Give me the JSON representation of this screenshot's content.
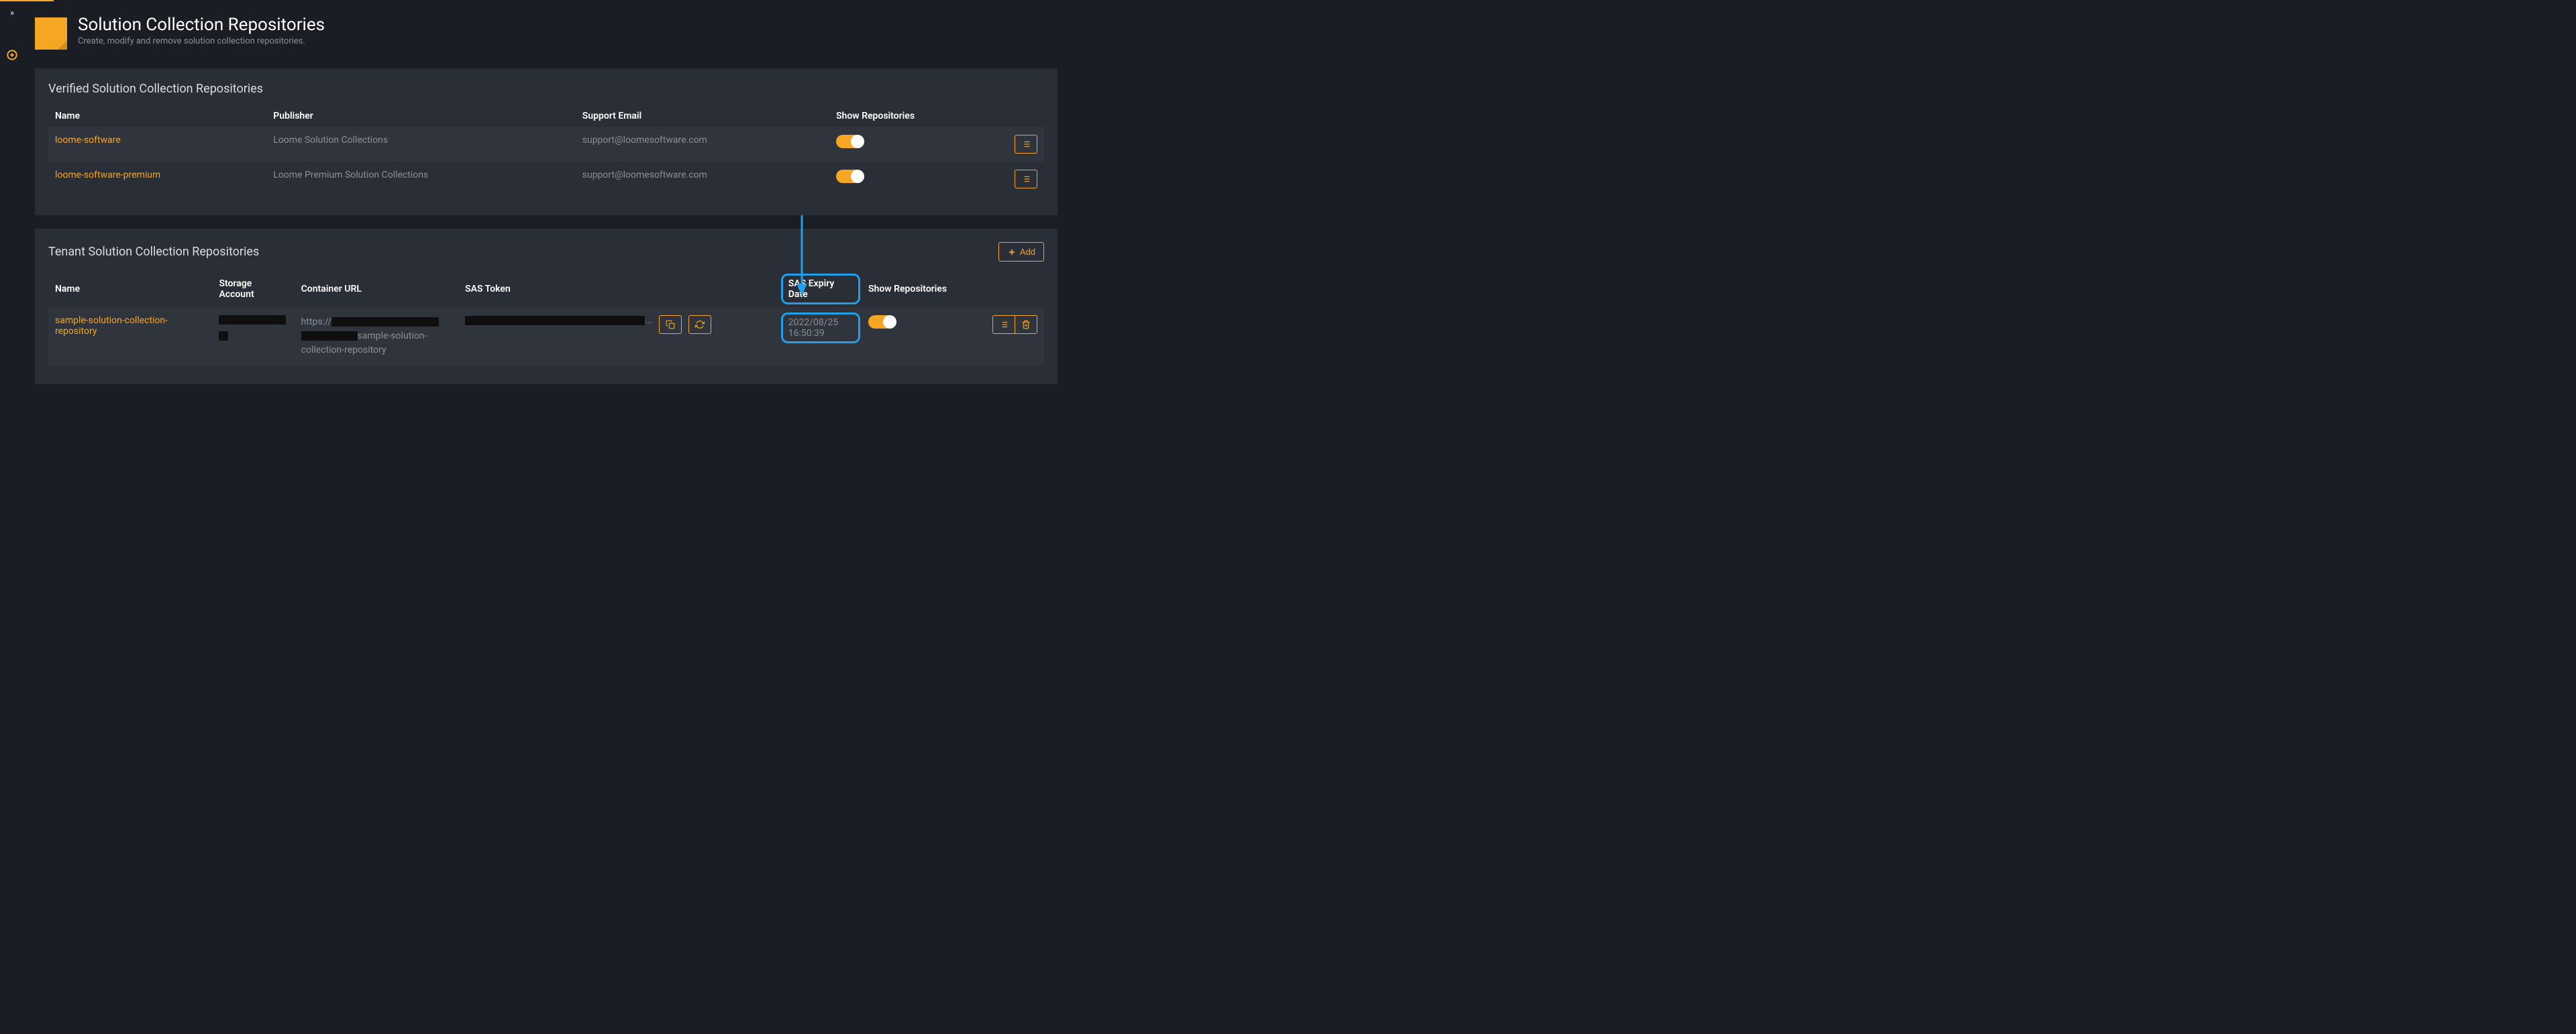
{
  "header": {
    "title": "Solution Collection Repositories",
    "subtitle": "Create, modify and remove solution collection repositories."
  },
  "verified": {
    "title": "Verified Solution Collection Repositories",
    "columns": {
      "name": "Name",
      "publisher": "Publisher",
      "support": "Support Email",
      "show": "Show Repositories"
    },
    "rows": [
      {
        "name": "loome-software",
        "publisher": "Loome Solution Collections",
        "support": "support@loomesoftware.com"
      },
      {
        "name": "loome-software-premium",
        "publisher": "Loome Premium Solution Collections",
        "support": "support@loomesoftware.com"
      }
    ]
  },
  "tenant": {
    "title": "Tenant Solution Collection Repositories",
    "add_label": "Add",
    "columns": {
      "name": "Name",
      "storage": "Storage Account",
      "url": "Container URL",
      "token": "SAS Token",
      "expiry": "SAS Expiry Date",
      "show": "Show Repositories"
    },
    "rows": [
      {
        "name": "sample-solution-collection-repository",
        "url_prefix": "https://",
        "url_suffix": "sample-solution-collection-repository",
        "token_ellipsis": "...",
        "expiry": "2022/08/25 16:50:39"
      }
    ]
  }
}
